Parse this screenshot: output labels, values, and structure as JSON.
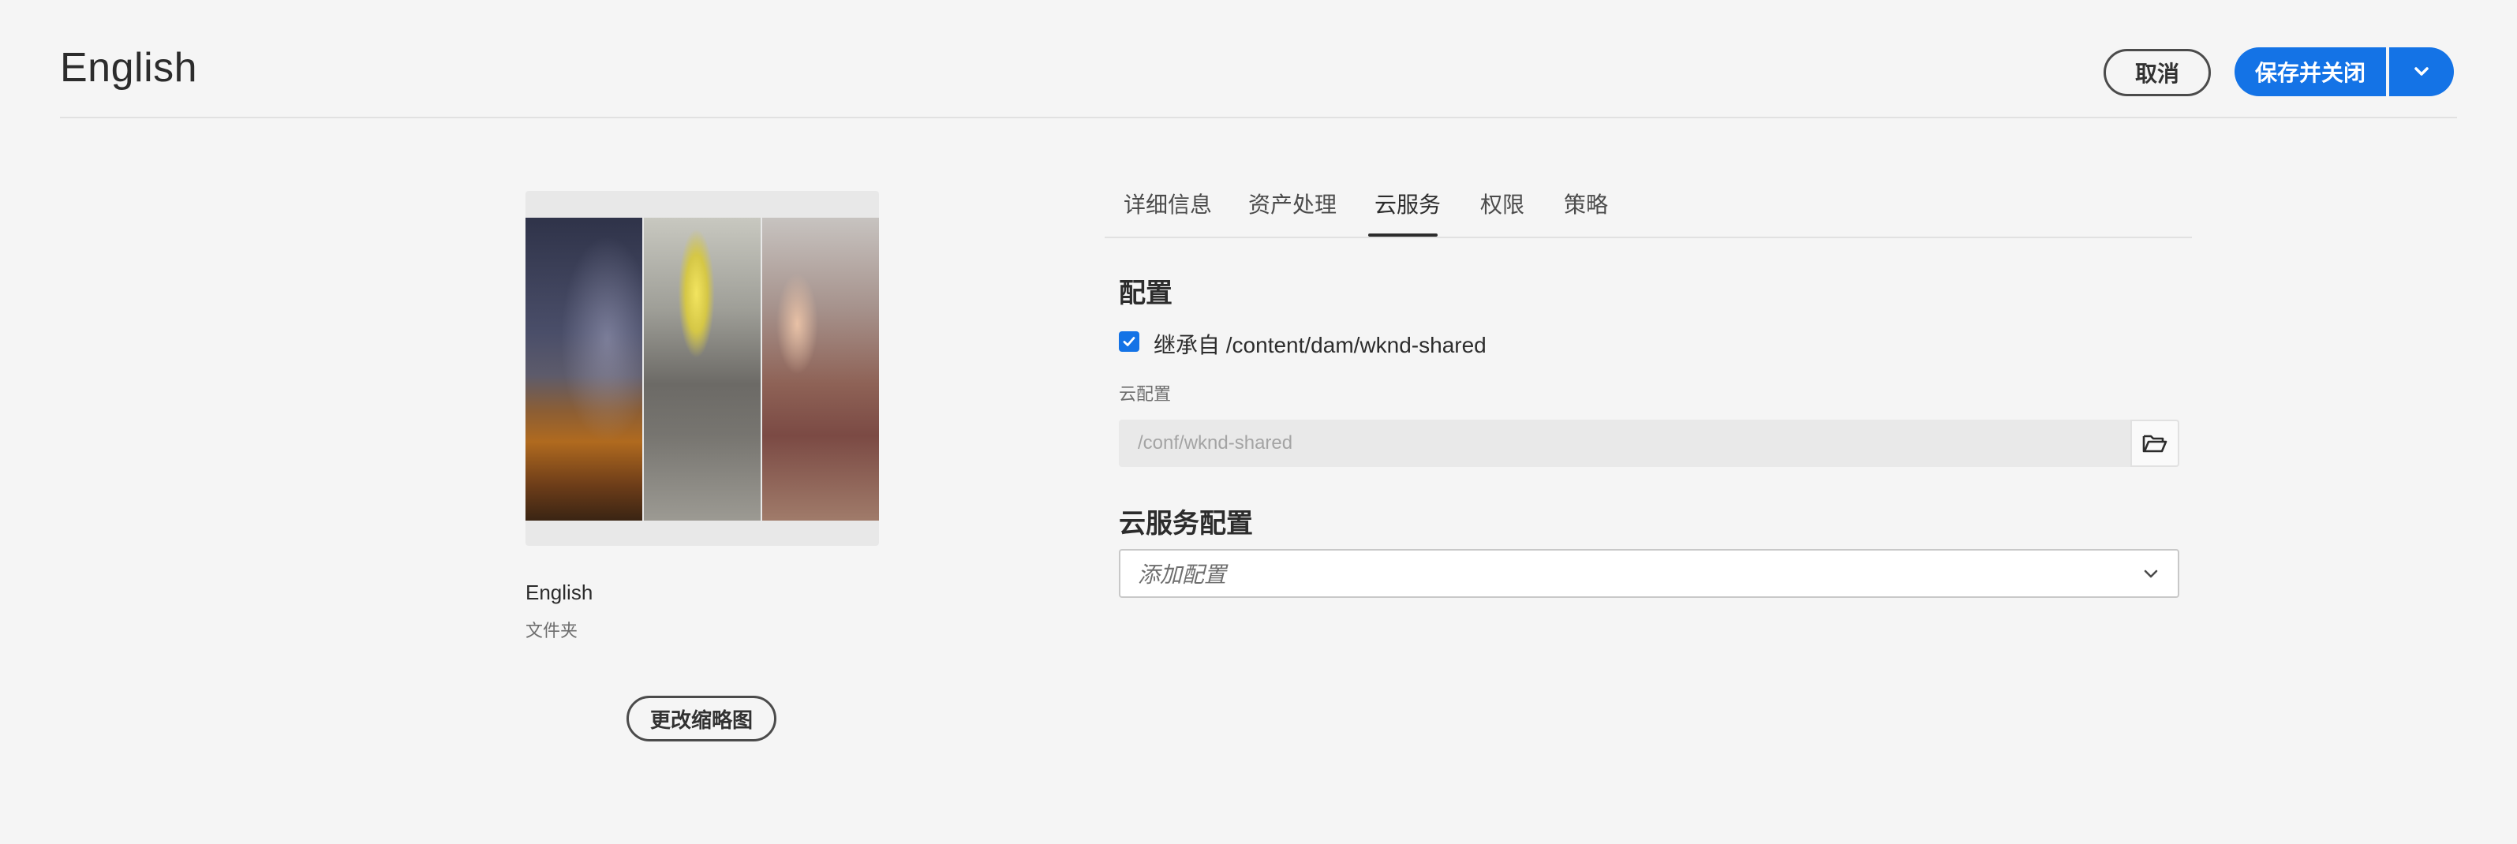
{
  "header": {
    "title": "English",
    "cancel_label": "取消",
    "save_label": "保存并关闭",
    "save_more_icon": "chevron-down-icon"
  },
  "thumbnail": {
    "name": "English",
    "type": "文件夹",
    "change_label": "更改缩略图"
  },
  "tabs": [
    {
      "label": "详细信息",
      "selected": false
    },
    {
      "label": "资产处理",
      "selected": false
    },
    {
      "label": "云服务",
      "selected": true
    },
    {
      "label": "权限",
      "selected": false
    },
    {
      "label": "策略",
      "selected": false
    }
  ],
  "configuration": {
    "title": "配置",
    "inherit_checked": true,
    "inherit_label": "继承自 /content/dam/wknd-shared",
    "cloud_config_label": "云配置",
    "cloud_config_value": "/conf/wknd-shared",
    "browse_icon": "folder-open-icon"
  },
  "cloud_services": {
    "title": "云服务配置",
    "select_placeholder": "添加配置"
  },
  "colors": {
    "accent": "#1473e6",
    "background": "#f5f5f5"
  }
}
